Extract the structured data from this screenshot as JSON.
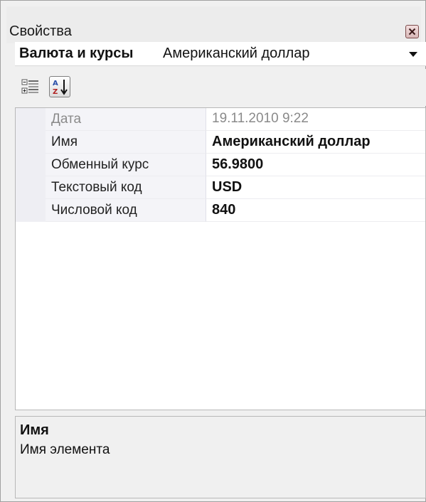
{
  "window": {
    "title": "Свойства"
  },
  "object_selector": {
    "object_name": "Валюта и курсы",
    "object_type": "Американский доллар"
  },
  "toolbar": {
    "buttons": [
      {
        "name": "categorized",
        "icon": "categorized-view-icon",
        "pressed": false
      },
      {
        "name": "alphabetical",
        "icon": "sort-az-icon",
        "pressed": true
      }
    ]
  },
  "properties": [
    {
      "name": "Дата",
      "value": "19.11.2010 9:22",
      "readonly": true
    },
    {
      "name": "Имя",
      "value": "Американский доллар",
      "readonly": false
    },
    {
      "name": "Обменный курс",
      "value": "56.9800",
      "readonly": false
    },
    {
      "name": "Текстовый код",
      "value": "USD",
      "readonly": false
    },
    {
      "name": "Числовой код",
      "value": "840",
      "readonly": false
    }
  ],
  "help": {
    "title": "Имя",
    "description": "Имя элемента"
  },
  "colors": {
    "window_bg": "#f0f0f0",
    "grid_bg": "#ffffff",
    "close_button": "#d9b9b9",
    "readonly_text": "#8a8a8a"
  }
}
